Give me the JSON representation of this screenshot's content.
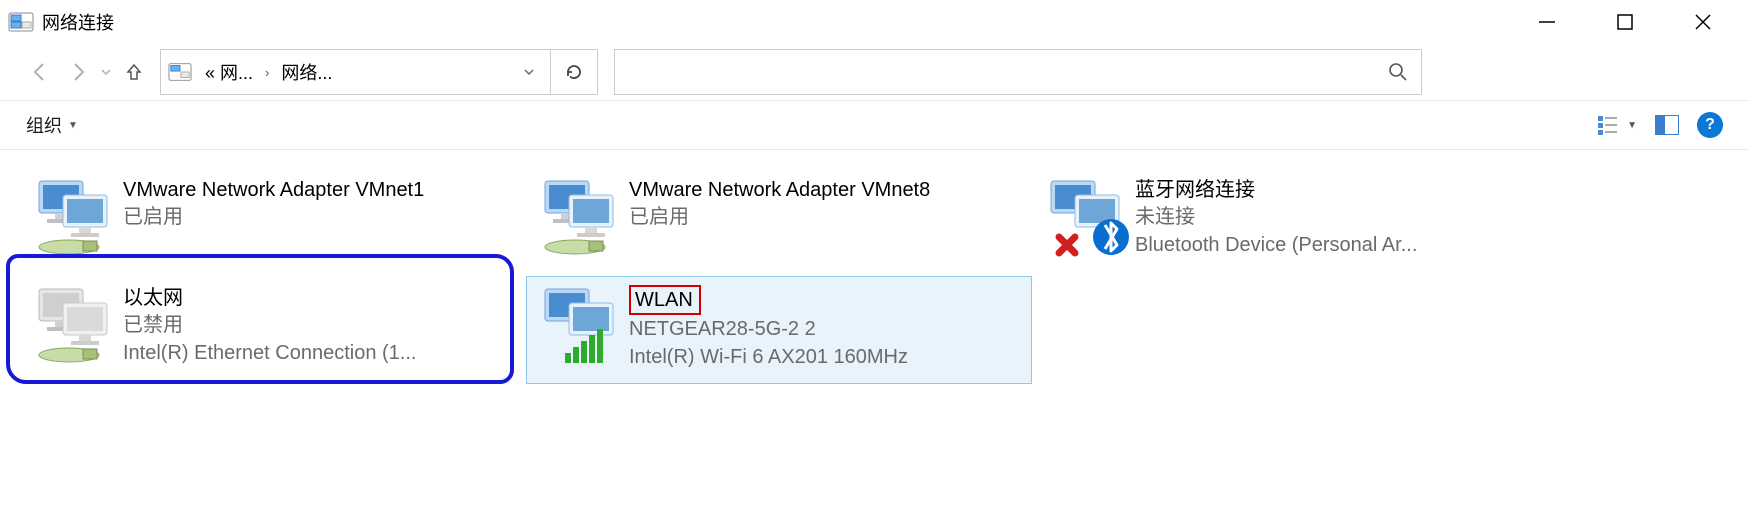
{
  "title": "网络连接",
  "breadcrumb": {
    "part1": "« 网...",
    "part2": "网络..."
  },
  "search_placeholder": "",
  "cmdbar": {
    "organize": "组织"
  },
  "items": [
    {
      "name": "VMware Network Adapter VMnet1",
      "status": "已启用",
      "detail": "",
      "icon": "net-enabled"
    },
    {
      "name": "VMware Network Adapter VMnet8",
      "status": "已启用",
      "detail": "",
      "icon": "net-enabled"
    },
    {
      "name": "蓝牙网络连接",
      "status": "未连接",
      "detail": "Bluetooth Device (Personal Ar...",
      "icon": "bluetooth-off"
    },
    {
      "name": "以太网",
      "status": "已禁用",
      "detail": "Intel(R) Ethernet Connection (1...",
      "icon": "net-disabled"
    },
    {
      "name": "WLAN",
      "status": "NETGEAR28-5G-2 2",
      "detail": "Intel(R) Wi-Fi 6 AX201 160MHz",
      "icon": "wifi"
    }
  ]
}
